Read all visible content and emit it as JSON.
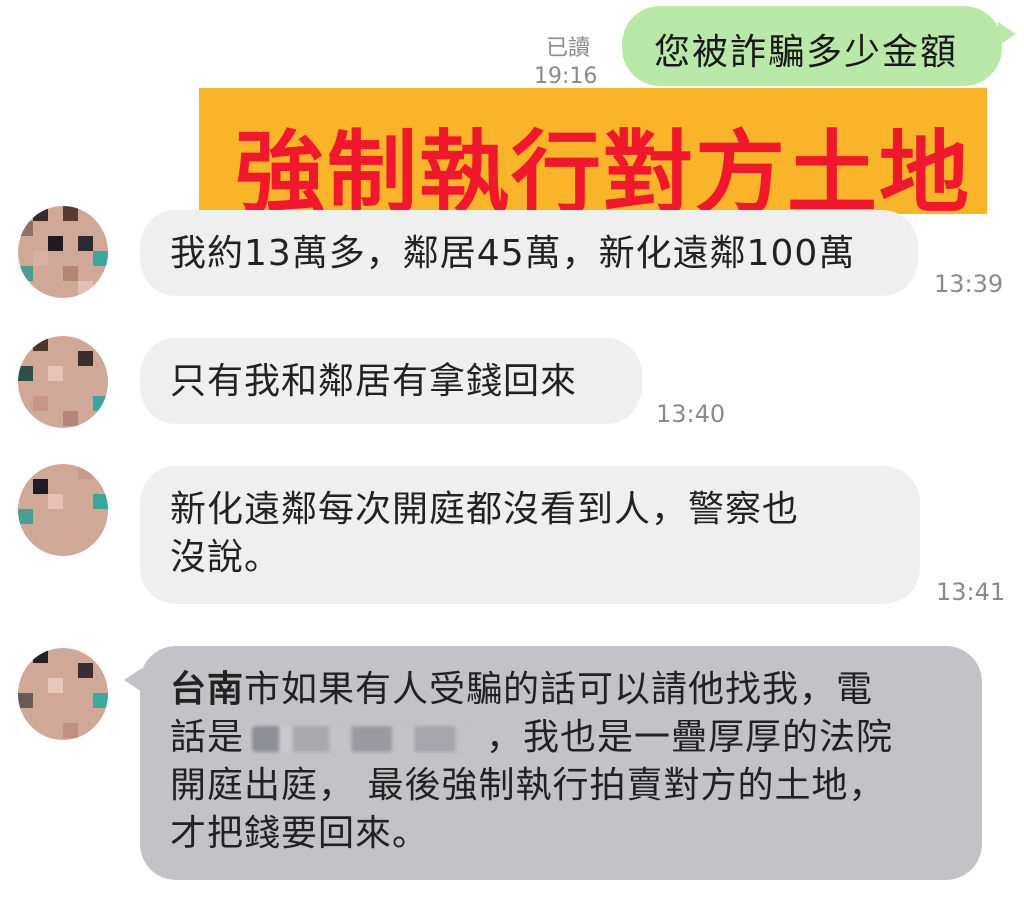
{
  "outgoing": {
    "read_label": "已讀",
    "time": "19:16",
    "text": "您被詐騙多少金額",
    "bubble_color": "#b9e8a9"
  },
  "banner": {
    "text": "強制執行對方土地",
    "background": "#f9b42a",
    "text_color": "#f0182c"
  },
  "incoming": [
    {
      "lines": [
        "我約13萬多，鄰居45萬，新化遠鄰100萬"
      ],
      "time": "13:39"
    },
    {
      "lines": [
        "只有我和鄰居有拿錢回來"
      ],
      "time": "13:40"
    },
    {
      "lines": [
        "新化遠鄰每次開庭都沒看到人，警察也",
        "沒說。"
      ],
      "time": "13:41"
    }
  ],
  "highlighted": {
    "bold_prefix": "台南",
    "line1_rest": "市如果有人受騙的話可以請他找我，電",
    "line2_prefix": "話是",
    "line2_suffix": "，我也是一疊厚厚的法院",
    "line3": "開庭出庭， 最後強制執行拍賣對方的土地，",
    "line4": "才把錢要回來。",
    "bubble_color": "#c3c3c7"
  },
  "avatar_icon": "blurred-profile-photo"
}
